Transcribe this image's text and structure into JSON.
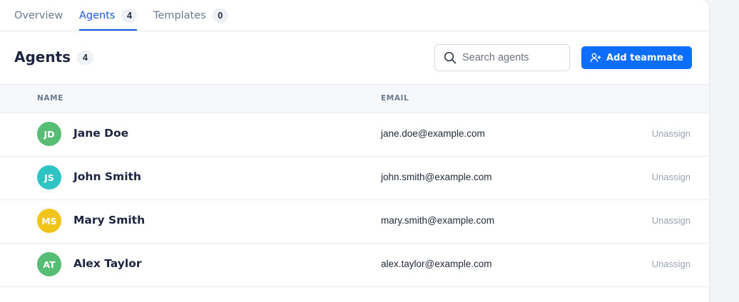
{
  "tabs": [
    {
      "label": "Overview",
      "count": ""
    },
    {
      "label": "Agents",
      "count": "4"
    },
    {
      "label": "Templates",
      "count": "0"
    }
  ],
  "header": {
    "title": "Agents",
    "count": "4"
  },
  "search": {
    "placeholder": "Search agents",
    "value": ""
  },
  "add_button": {
    "label": "Add teammate",
    "icon": "user-plus-icon"
  },
  "table": {
    "columns": [
      "NAME",
      "EMAIL"
    ],
    "rows": [
      {
        "initials": "JD",
        "name": "Jane Doe",
        "email": "jane.doe@example.com",
        "action": "Unassign",
        "color": "#55bd74"
      },
      {
        "initials": "JS",
        "name": "John Smith",
        "email": "john.smith@example.com",
        "action": "Unassign",
        "color": "#2ec4c4"
      },
      {
        "initials": "MS",
        "name": "Mary Smith",
        "email": "mary.smith@example.com",
        "action": "Unassign",
        "color": "#f0c419"
      },
      {
        "initials": "AT",
        "name": "Alex Taylor",
        "email": "alex.taylor@example.com",
        "action": "Unassign",
        "color": "#55bd74"
      }
    ]
  },
  "colors": {
    "accent": "#1a56db",
    "button": "#0d6efd"
  }
}
